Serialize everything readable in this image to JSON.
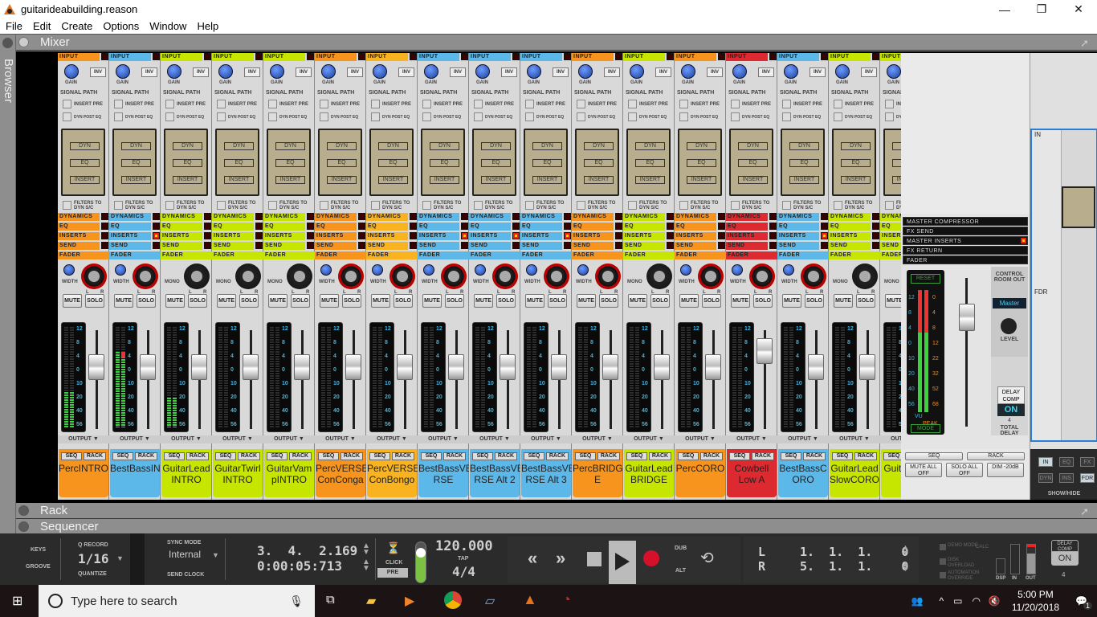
{
  "window": {
    "title": "guitarideabuilding.reason",
    "minimize": "—",
    "restore": "❐",
    "close": "✕"
  },
  "menu": [
    "File",
    "Edit",
    "Create",
    "Options",
    "Window",
    "Help"
  ],
  "panels": {
    "browser": "Browser",
    "mixer": "Mixer",
    "rack": "Rack",
    "sequencer": "Sequencer"
  },
  "strip_labels": {
    "input": "INPUT",
    "inv": "INV",
    "gain": "GAIN",
    "signal_path": "SIGNAL PATH",
    "insert_pre": "INSERT PRE",
    "dyn_post_eq": "DYN POST EQ",
    "dyn": "DYN",
    "eq": "EQ",
    "insert": "INSERT",
    "filters": "FILTERS TO DYN S/C",
    "dynamics": "DYNAMICS",
    "eq_bar": "EQ",
    "inserts": "INSERTS",
    "send": "SEND",
    "fader": "FADER",
    "width": "WIDTH",
    "mono": "MONO",
    "l": "L",
    "r": "R",
    "mute": "MUTE",
    "solo": "SOLO",
    "output": "OUTPUT ▼",
    "seq": "SEQ",
    "rack": "RACK"
  },
  "meter_scale": [
    "12",
    "8",
    "4",
    "0",
    "10",
    "20",
    "40",
    "56"
  ],
  "channels": [
    {
      "name": "PercINTRO",
      "color": "#f7941d",
      "width": true,
      "inserts_on": false,
      "level": 0.35,
      "fader": 0.7
    },
    {
      "name": "BestBassINTRO",
      "color": "#5bb8e8",
      "width": true,
      "inserts_on": true,
      "level": 0.75,
      "fader": 0.7
    },
    {
      "name": "GuitarLead INTRO",
      "color": "#c6e600",
      "width": false,
      "inserts_on": false,
      "level": 0.3,
      "fader": 0.7
    },
    {
      "name": "GuitarTwirl INTRO",
      "color": "#c6e600",
      "width": false,
      "inserts_on": false,
      "level": 0,
      "fader": 0.7
    },
    {
      "name": "GuitarVam pINTRO",
      "color": "#c6e600",
      "width": false,
      "inserts_on": false,
      "level": 0,
      "fader": 0.7
    },
    {
      "name": "PercVERSE ConConga",
      "color": "#f7941d",
      "width": true,
      "inserts_on": false,
      "level": 0,
      "fader": 0.7
    },
    {
      "name": "PercVERSE ConBongo",
      "color": "#f9b320",
      "width": true,
      "inserts_on": false,
      "level": 0,
      "fader": 0.7
    },
    {
      "name": "BestBassVE RSE",
      "color": "#5bb8e8",
      "width": true,
      "inserts_on": true,
      "level": 0,
      "fader": 0.7
    },
    {
      "name": "BestBassVE RSE Alt 2",
      "color": "#5bb8e8",
      "width": true,
      "inserts_on": true,
      "level": 0,
      "fader": 0.7
    },
    {
      "name": "BestBassVE RSE Alt 3",
      "color": "#5bb8e8",
      "width": true,
      "inserts_on": true,
      "level": 0,
      "fader": 0.7
    },
    {
      "name": "PercBRIDG E",
      "color": "#f7941d",
      "width": true,
      "inserts_on": false,
      "level": 0,
      "fader": 0.7
    },
    {
      "name": "GuitarLead BRIDGE",
      "color": "#c6e600",
      "width": false,
      "inserts_on": false,
      "level": 0,
      "fader": 0.7
    },
    {
      "name": "PercCORO",
      "color": "#f7941d",
      "width": true,
      "inserts_on": false,
      "level": 0,
      "fader": 0.7
    },
    {
      "name": "Cowbell Low A",
      "color": "#dd2a30",
      "width": true,
      "inserts_on": false,
      "level": 0,
      "fader": 0.9
    },
    {
      "name": "BestBassC ORO",
      "color": "#5bb8e8",
      "width": true,
      "inserts_on": true,
      "level": 0,
      "fader": 0.7
    },
    {
      "name": "GuitarLead SlowCORO",
      "color": "#c6e600",
      "width": false,
      "inserts_on": false,
      "level": 0,
      "fader": 0.7
    },
    {
      "name": "Guita Fast",
      "color": "#c6e600",
      "width": false,
      "inserts_on": false,
      "level": 0,
      "fader": 0.7
    }
  ],
  "master": {
    "bars": [
      "MASTER COMPRESSOR",
      "FX SEND",
      "MASTER INSERTS",
      "FX RETURN",
      "FADER"
    ],
    "reset": "RESET",
    "mode": "MODE",
    "vu": "VU",
    "peak": "PEAK",
    "vu_scale": [
      "12",
      "8",
      "4",
      "0",
      "10",
      "20",
      "40",
      "56"
    ],
    "peak_scale": [
      "0",
      "4",
      "8",
      "12",
      "22",
      "32",
      "52",
      "68"
    ],
    "control_room": "CONTROL ROOM OUT",
    "control_room_value": "Master",
    "level": "LEVEL",
    "delay_comp": "DELAY COMP",
    "delay_on": "ON",
    "total_delay_value": "4",
    "total_delay": "TOTAL DELAY",
    "seq": "SEQ",
    "rack": "RACK",
    "mute_all": "MUTE ALL OFF",
    "solo_all": "SOLO ALL OFF",
    "dim": "DIM -20dB"
  },
  "showhide": {
    "buttons": [
      "IN",
      "EQ",
      "FX",
      "DYN",
      "INS",
      "FDR"
    ],
    "active": [
      "IN",
      "FDR"
    ],
    "label": "SHOW/HIDE",
    "in_label": "IN",
    "fdr_label": "FDR"
  },
  "transport": {
    "keys": "KEYS",
    "groove": "GROOVE",
    "q_record": "Q RECORD",
    "quantize_value": "1/16",
    "quantize": "QUANTIZE",
    "sync_mode": "SYNC MODE",
    "sync_value": "Internal",
    "send_clock": "SEND CLOCK",
    "position_bars": "3.  4.  2.169",
    "position_time": "0:00:05:713",
    "click": "CLICK",
    "pre": "PRE",
    "tempo": "120.000",
    "tap": "TAP",
    "signature": "4/4",
    "dub": "DUB",
    "alt": "ALT",
    "loop_l_label": "L",
    "loop_r_label": "R",
    "loop_l": "1.  1.  1.    0",
    "loop_r": "5.  1.  1.    0",
    "demo_mode": "DEMO MODE",
    "disk_overload": "DISK OVERLOAD",
    "automation_override": "AUTOMATION OVERRIDE",
    "calc": "CALC",
    "dsp": "DSP",
    "in": "IN",
    "out": "OUT",
    "delay_comp": "DELAY COMP",
    "delay_on": "ON",
    "delay_value": "4"
  },
  "taskbar": {
    "search_placeholder": "Type here to search",
    "time": "5:00 PM",
    "date": "11/20/2018",
    "notifications": "1"
  }
}
